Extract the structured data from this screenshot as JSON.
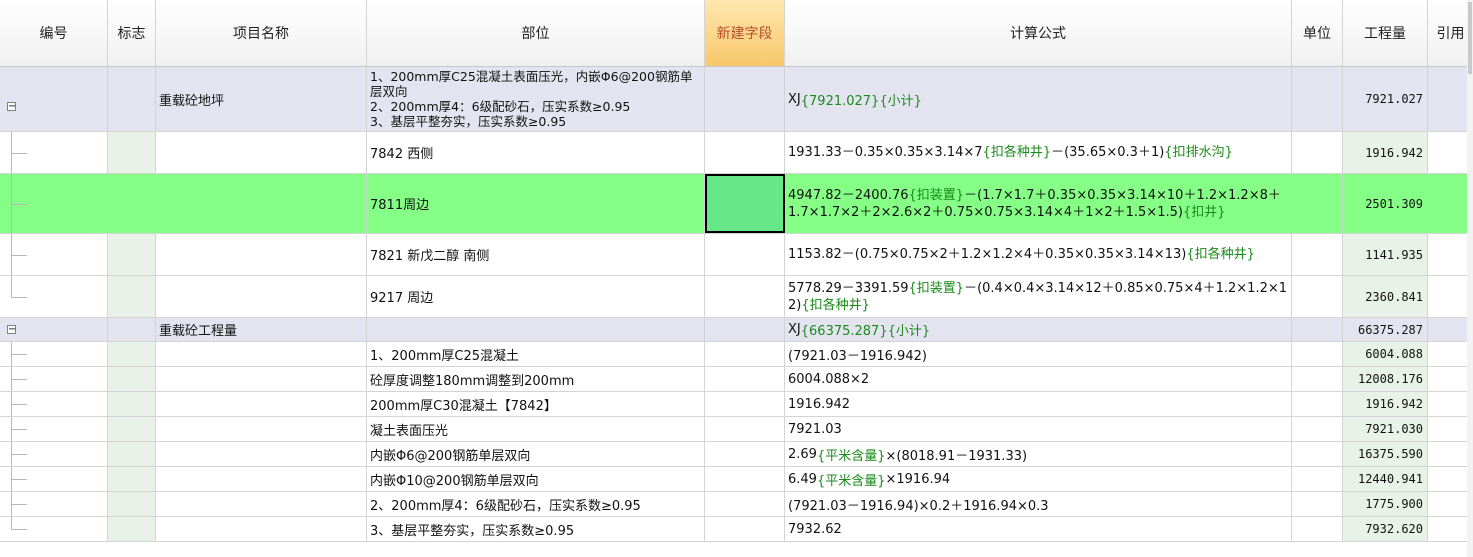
{
  "headers": {
    "code": "编号",
    "flag": "标志",
    "name": "项目名称",
    "part": "部位",
    "new_field": "新建字段",
    "formula": "计算公式",
    "unit": "单位",
    "qty": "工程量",
    "ref": "引用"
  },
  "groups": [
    {
      "name": "重载砼地坪",
      "part": "1、200mm厚C25混凝土表面压光，内嵌Φ6@200钢筋单层双向\n2、200mm厚4：6级配砂石，压实系数≥0.95\n3、基层平整夯实，压实系数≥0.95",
      "formula_main": "XJ",
      "formula_kw": "{7921.027}{小计}",
      "qty": "7921.027",
      "toggle": "−"
    },
    {
      "name": "重载砼工程量",
      "part": "",
      "formula_main": "XJ",
      "formula_kw": "{66375.287}{小计}",
      "qty": "66375.287",
      "toggle": "−"
    }
  ],
  "rows_g1": [
    {
      "part": "7842 西侧",
      "f1": "1931.33－0.35×0.35×3.14×7",
      "f2": "{扣各种井}",
      "f3": "－(35.65×0.3＋1)",
      "f4": "{扣排水沟}",
      "qty": "1916.942"
    },
    {
      "part": "7811周边",
      "f1": "4947.82－2400.76",
      "f2": "{扣装置}",
      "f3": "－(1.7×1.7＋0.35×0.35×3.14×10＋1.2×1.2×8＋1.7×1.7×2＋2×2.6×2＋0.75×0.75×3.14×4＋1×2＋1.5×1.5)",
      "f4": "{扣井}",
      "qty": "2501.309"
    },
    {
      "part": "7821 新戊二醇 南侧",
      "f1": "1153.82－(0.75×0.75×2＋1.2×1.2×4＋0.35×0.35×3.14×13)",
      "f2": "{扣各种井}",
      "f3": "",
      "f4": "",
      "qty": "1141.935"
    },
    {
      "part": "9217 周边",
      "f1": "5778.29－3391.59",
      "f2": "{扣装置}",
      "f3": "－(0.4×0.4×3.14×12＋0.85×0.75×4＋1.2×1.2×12)",
      "f4": "{扣各种井}",
      "qty": "2360.841"
    }
  ],
  "rows_g2": [
    {
      "part": "1、200mm厚C25混凝土",
      "f1": "(7921.03－1916.942)",
      "f2": "",
      "f3": "",
      "qty": "6004.088"
    },
    {
      "part": "砼厚度调整180mm调整到200mm",
      "f1": "6004.088×2",
      "f2": "",
      "f3": "",
      "qty": "12008.176"
    },
    {
      "part": "200mm厚C30混凝土【7842】",
      "f1": "1916.942",
      "f2": "",
      "f3": "",
      "qty": "1916.942"
    },
    {
      "part": "凝土表面压光",
      "f1": "7921.03",
      "f2": "",
      "f3": "",
      "qty": "7921.030"
    },
    {
      "part": "内嵌Φ6@200钢筋单层双向",
      "f1": "2.69",
      "f2": "{平米含量}",
      "f3": "×(8018.91－1931.33)",
      "qty": "16375.590"
    },
    {
      "part": "内嵌Φ10@200钢筋单层双向",
      "f1": "6.49",
      "f2": "{平米含量}",
      "f3": "×1916.94",
      "qty": "12440.941"
    },
    {
      "part": "2、200mm厚4：6级配砂石，压实系数≥0.95",
      "f1": "(7921.03－1916.94)×0.2＋1916.94×0.3",
      "f2": "",
      "f3": "",
      "qty": "1775.900"
    },
    {
      "part": "3、基层平整夯实，压实系数≥0.95",
      "f1": "7932.62",
      "f2": "",
      "f3": "",
      "qty": "7932.620"
    }
  ],
  "colors": {
    "header_highlight": "#f7c76a",
    "group_bg": "#e4e4f1",
    "selected_row_bg": "#85ff85",
    "formula_keyword": "#1a8a1a"
  }
}
